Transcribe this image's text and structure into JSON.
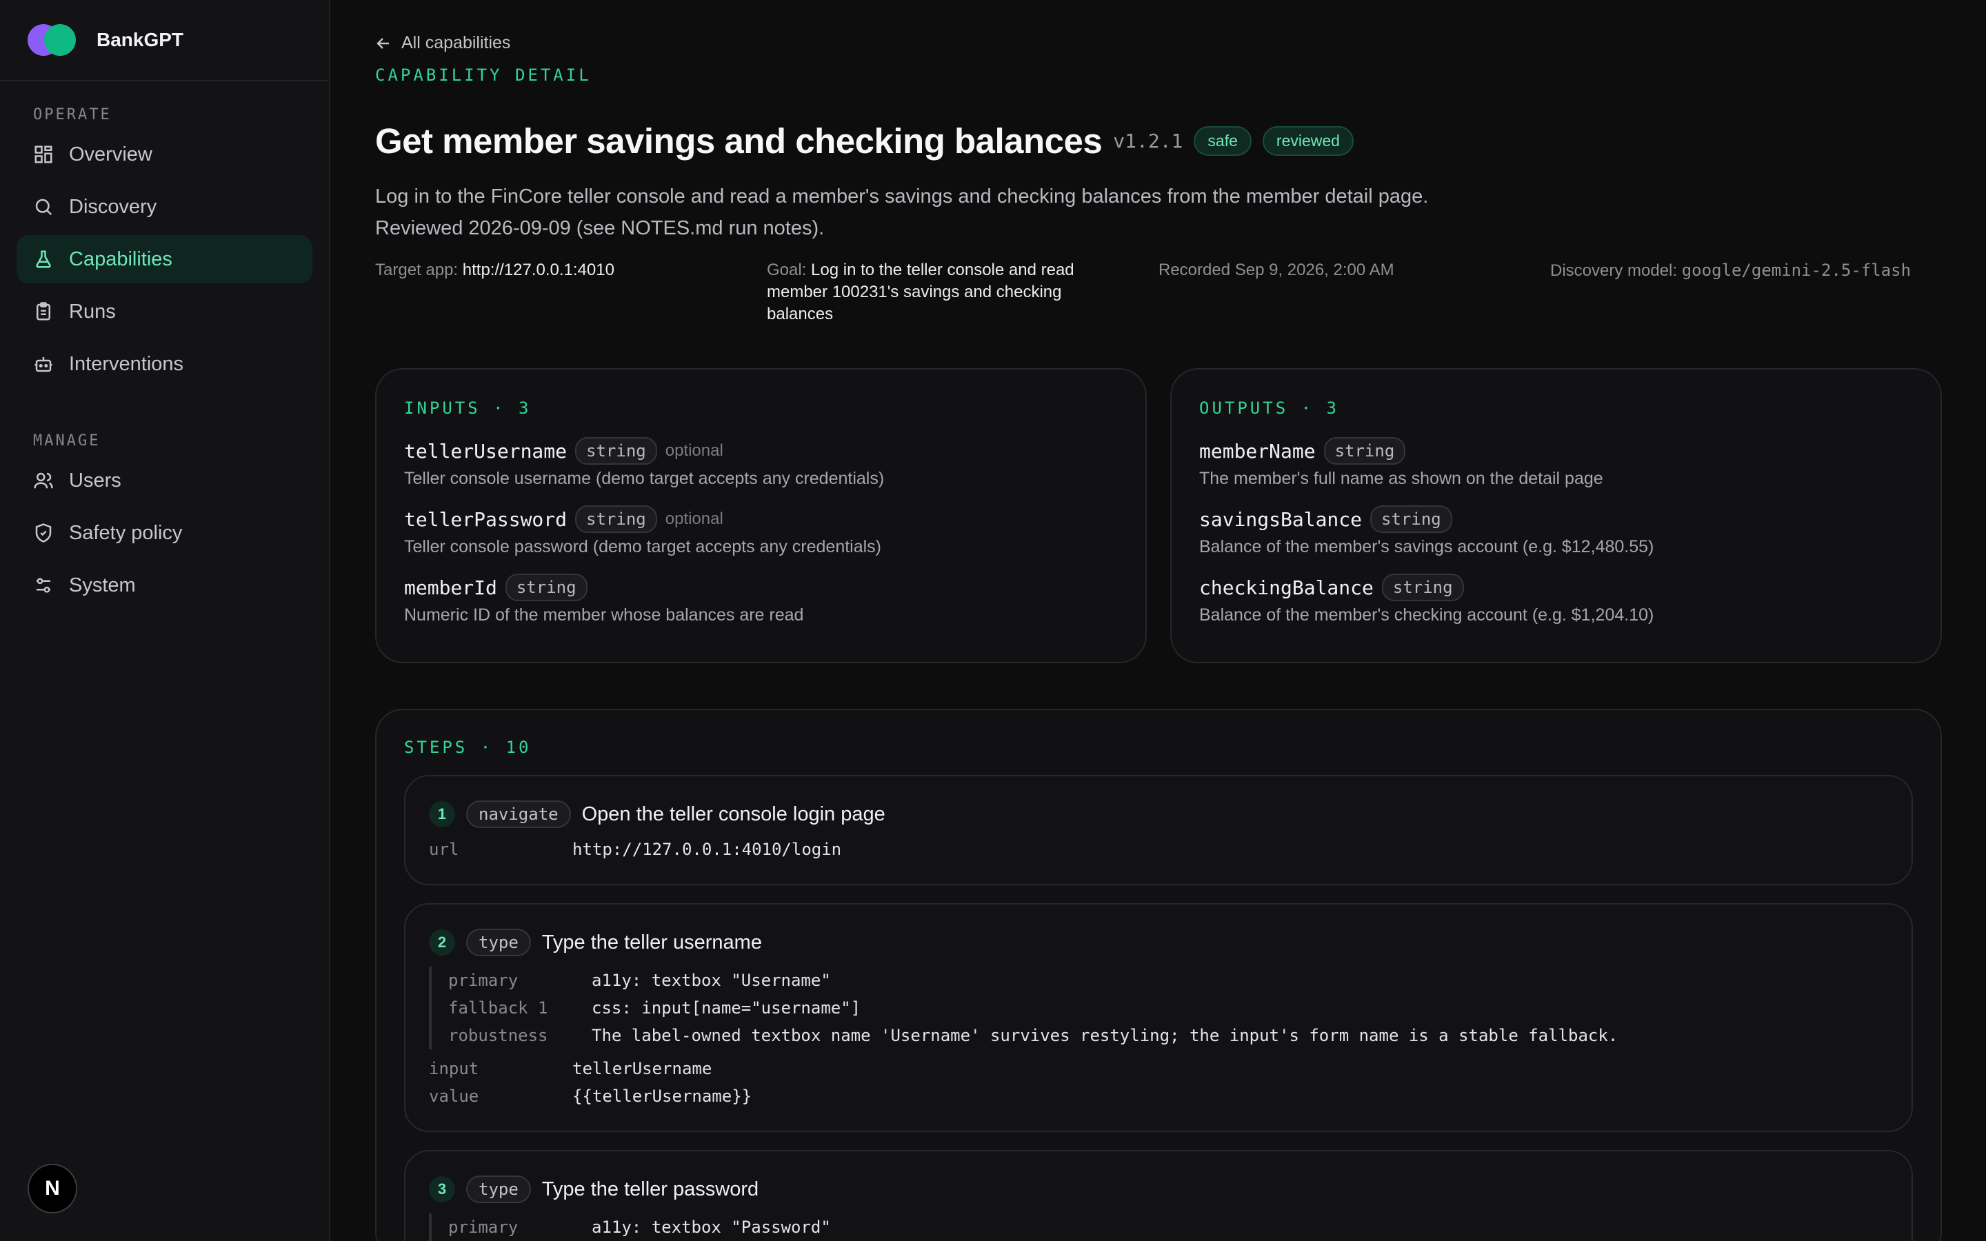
{
  "app": {
    "name": "BankGPT"
  },
  "sidebar": {
    "sections": [
      {
        "label": "OPERATE",
        "items": [
          {
            "label": "Overview",
            "icon": "grid-icon"
          },
          {
            "label": "Discovery",
            "icon": "search-icon"
          },
          {
            "label": "Capabilities",
            "icon": "flask-icon",
            "active": true
          },
          {
            "label": "Runs",
            "icon": "clipboard-icon"
          },
          {
            "label": "Interventions",
            "icon": "robot-icon"
          }
        ]
      },
      {
        "label": "MANAGE",
        "items": [
          {
            "label": "Users",
            "icon": "users-icon"
          },
          {
            "label": "Safety policy",
            "icon": "shield-icon"
          },
          {
            "label": "System",
            "icon": "sliders-icon"
          }
        ]
      }
    ],
    "footer_badge": "N"
  },
  "header": {
    "back_label": "All capabilities",
    "eyebrow": "CAPABILITY DETAIL",
    "title": "Get member savings and checking balances",
    "version": "v1.2.1",
    "badges": [
      "safe",
      "reviewed"
    ],
    "description": "Log in to the FinCore teller console and read a member's savings and checking balances from the member detail page. Reviewed 2026-09-09 (see NOTES.md run notes).",
    "meta": {
      "target_label": "Target app:",
      "target_value": "http://127.0.0.1:4010",
      "goal_label": "Goal:",
      "goal_value": "Log in to the teller console and read member 100231's savings and checking balances",
      "recorded": "Recorded Sep 9, 2026, 2:00 AM",
      "model_label": "Discovery model:",
      "model_value": "google/gemini-2.5-flash"
    }
  },
  "inputs": {
    "heading": "INPUTS · 3",
    "fields": [
      {
        "name": "tellerUsername",
        "type": "string",
        "optional": "optional",
        "desc": "Teller console username (demo target accepts any credentials)"
      },
      {
        "name": "tellerPassword",
        "type": "string",
        "optional": "optional",
        "desc": "Teller console password (demo target accepts any credentials)"
      },
      {
        "name": "memberId",
        "type": "string",
        "optional": "",
        "desc": "Numeric ID of the member whose balances are read"
      }
    ]
  },
  "outputs": {
    "heading": "OUTPUTS · 3",
    "fields": [
      {
        "name": "memberName",
        "type": "string",
        "desc": "The member's full name as shown on the detail page"
      },
      {
        "name": "savingsBalance",
        "type": "string",
        "desc": "Balance of the member's savings account (e.g. $12,480.55)"
      },
      {
        "name": "checkingBalance",
        "type": "string",
        "desc": "Balance of the member's checking account (e.g. $1,204.10)"
      }
    ]
  },
  "steps": {
    "heading": "STEPS · 10",
    "items": [
      {
        "num": "1",
        "kind": "navigate",
        "title": "Open the teller console login page",
        "kv": [
          {
            "k": "url",
            "v": "http://127.0.0.1:4010/login"
          }
        ]
      },
      {
        "num": "2",
        "kind": "type",
        "title": "Type the teller username",
        "locator": [
          {
            "k": "primary",
            "v": "a11y: textbox \"Username\""
          },
          {
            "k": "fallback 1",
            "v": "css: input[name=\"username\"]"
          },
          {
            "k": "robustness",
            "v": "The label-owned textbox name 'Username' survives restyling; the input's form name is a stable fallback."
          }
        ],
        "kv": [
          {
            "k": "input",
            "v": "tellerUsername"
          },
          {
            "k": "value",
            "v": "{{tellerUsername}}"
          }
        ]
      },
      {
        "num": "3",
        "kind": "type",
        "title": "Type the teller password",
        "locator": [
          {
            "k": "primary",
            "v": "a11y: textbox \"Password\""
          }
        ],
        "kv": []
      }
    ]
  }
}
